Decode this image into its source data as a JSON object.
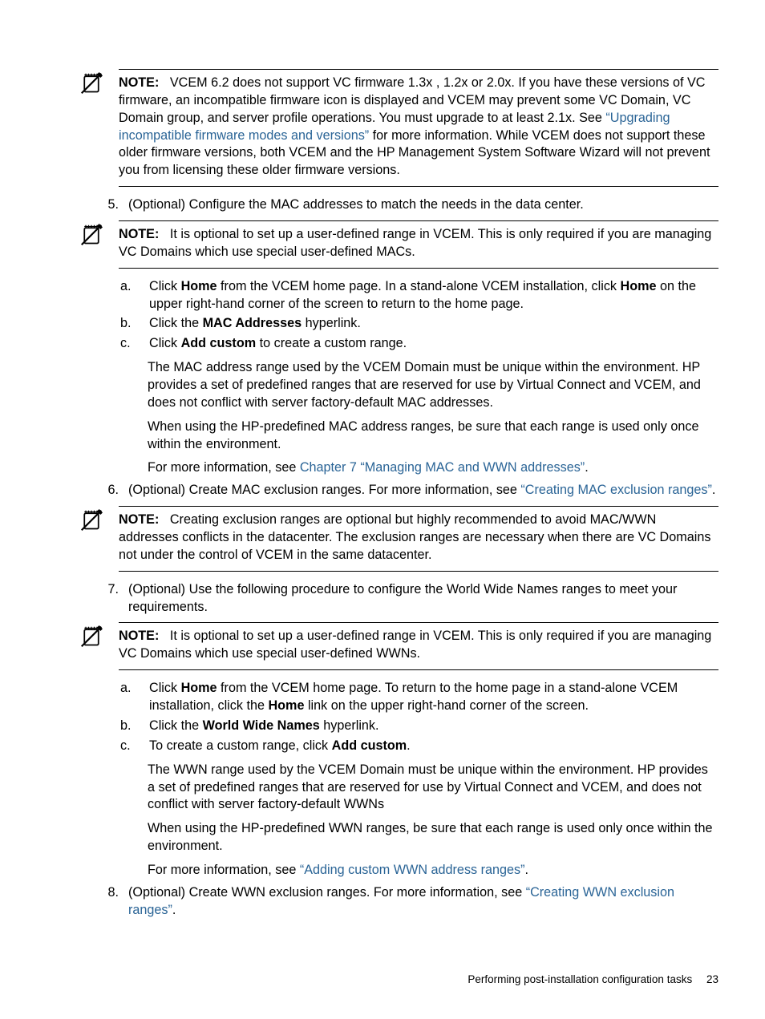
{
  "notes": {
    "n1": {
      "label": "NOTE:",
      "pre": "VCEM 6.2 does not support VC firmware 1.3x , 1.2x or 2.0x. If you have these versions of VC firmware, an incompatible firmware icon is displayed and VCEM may prevent some VC Domain, VC Domain group, and server profile operations. You must upgrade to at least 2.1x. See ",
      "link": "“Upgrading incompatible firmware modes and versions”",
      "post": " for more information. While VCEM does not support these older firmware versions, both VCEM and the HP Management System Software Wizard will not prevent you from licensing these older firmware versions."
    },
    "n2": {
      "label": "NOTE:",
      "text": "It is optional to set up a user-defined range in VCEM. This is only required if you are managing VC Domains which use special user-defined MACs."
    },
    "n3": {
      "label": "NOTE:",
      "text": "Creating exclusion ranges are optional but highly recommended to avoid MAC/WWN addresses conflicts in the datacenter. The exclusion ranges are necessary when there are VC Domains not under the control of VCEM in the same datacenter."
    },
    "n4": {
      "label": "NOTE:",
      "text": "It is optional to set up a user-defined range in VCEM. This is only required if you are managing VC Domains which use special user-defined WWNs."
    }
  },
  "steps": {
    "s5": {
      "marker": "5.",
      "text": "(Optional) Configure the MAC addresses to match the needs in the data center."
    },
    "s5sub": {
      "a_m": "a.",
      "a_pre": "Click ",
      "a_b1": "Home",
      "a_mid": " from the VCEM home page. In a stand-alone VCEM installation, click ",
      "a_b2": "Home",
      "a_post": " on the upper right-hand corner of the screen to return to the home page.",
      "b_m": "b.",
      "b_pre": "Click the ",
      "b_b": "MAC Addresses",
      "b_post": " hyperlink.",
      "c_m": "c.",
      "c_pre": "Click ",
      "c_b": "Add custom",
      "c_post": " to create a custom range.",
      "p1": "The MAC address range used by the VCEM Domain must be unique within the environment. HP provides a set of predefined ranges that are reserved for use by Virtual Connect and VCEM, and does not conflict with server factory-default MAC addresses.",
      "p2": "When using the HP-predefined MAC address ranges, be sure that each range is used only once within the environment.",
      "p3_pre": "For more information, see ",
      "p3_link": "Chapter 7 “Managing MAC and WWN addresses”",
      "p3_post": "."
    },
    "s6": {
      "marker": "6.",
      "pre": "(Optional) Create MAC exclusion ranges. For more information, see ",
      "link": "“Creating MAC exclusion ranges”",
      "post": "."
    },
    "s7": {
      "marker": "7.",
      "text": "(Optional) Use the following procedure to configure the World Wide Names ranges to meet your requirements."
    },
    "s7sub": {
      "a_m": "a.",
      "a_pre": "Click ",
      "a_b1": "Home",
      "a_mid": " from the VCEM home page. To return to the home page in a stand-alone VCEM installation, click the ",
      "a_b2": "Home",
      "a_post": " link on the upper right-hand corner of the screen.",
      "b_m": "b.",
      "b_pre": "Click the ",
      "b_b": "World Wide Names",
      "b_post": " hyperlink.",
      "c_m": "c.",
      "c_pre": "To create a custom range, click ",
      "c_b": "Add custom",
      "c_post": ".",
      "p1": "The WWN range used by the VCEM Domain must be unique within the environment. HP provides a set of predefined ranges that are reserved for use by Virtual Connect and VCEM, and does not conflict with server factory-default WWNs",
      "p2": "When using the HP-predefined WWN ranges, be sure that each range is used only once within the environment.",
      "p3_pre": "For more information, see ",
      "p3_link": "“Adding custom WWN address ranges”",
      "p3_post": "."
    },
    "s8": {
      "marker": "8.",
      "pre": "(Optional) Create WWN exclusion ranges. For more information, see ",
      "link": "“Creating WWN exclusion ranges”",
      "post": "."
    }
  },
  "footer": {
    "text": "Performing post-installation configuration tasks",
    "page": "23"
  }
}
